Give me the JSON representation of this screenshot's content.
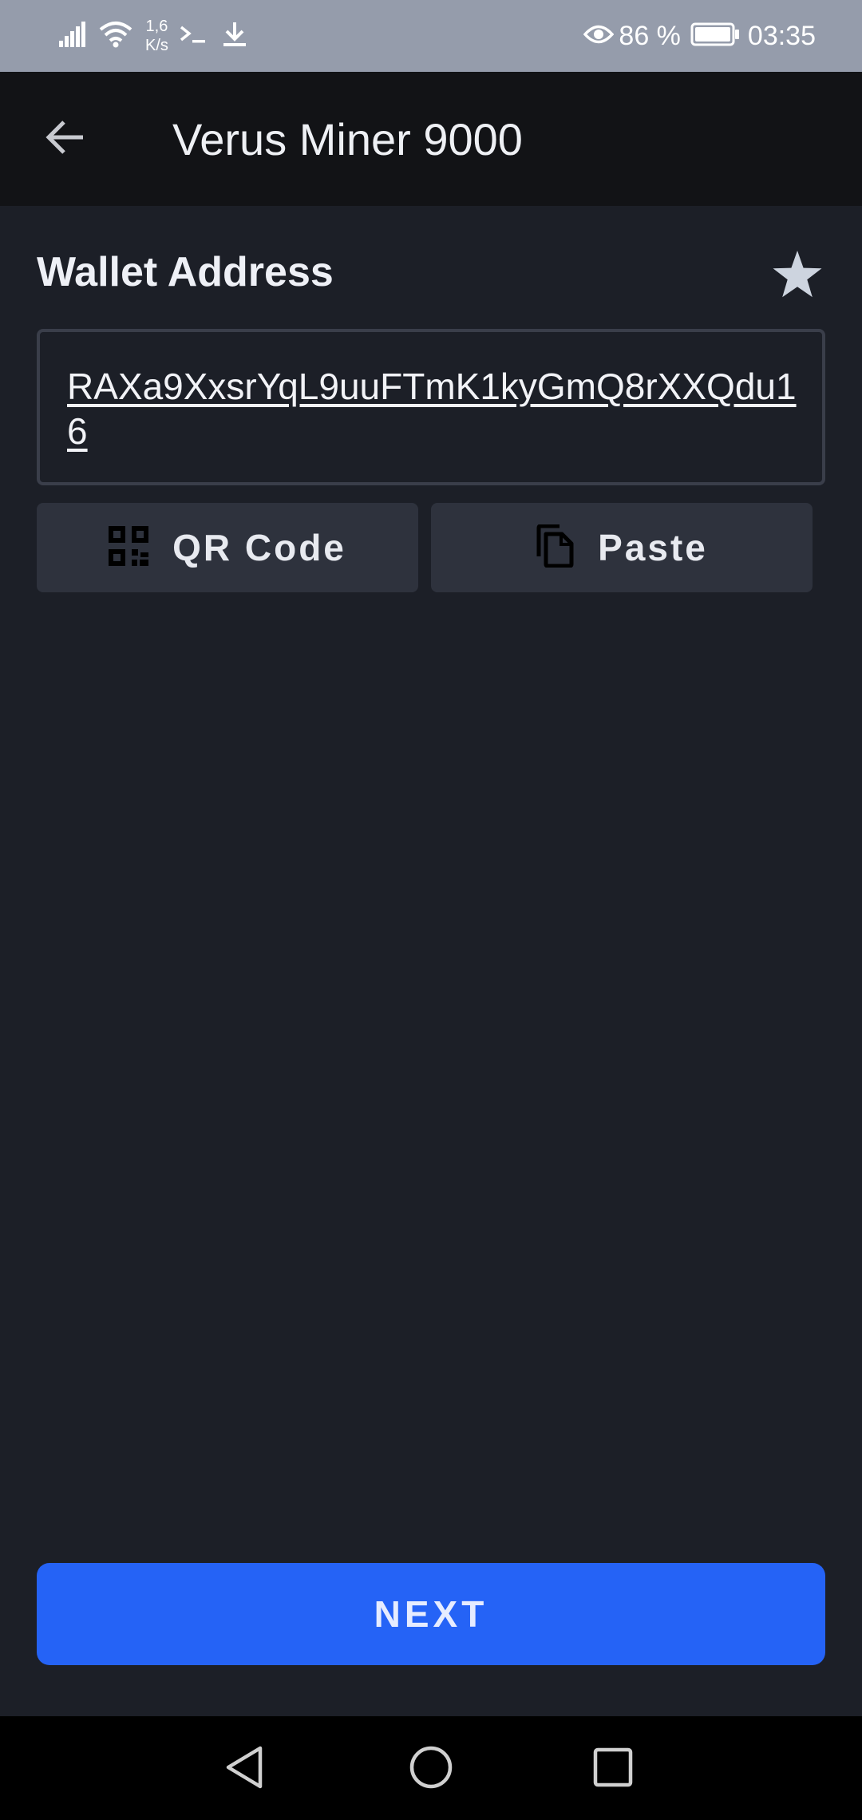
{
  "status_bar": {
    "net_speed_value": "1,6",
    "net_speed_unit": "K/s",
    "battery_percent": "86 %",
    "time": "03:35"
  },
  "app_bar": {
    "title": "Verus Miner 9000"
  },
  "wallet": {
    "section_title": "Wallet Address",
    "address_value": "RAXa9XxsrYqL9uuFTmK1kyGmQ8rXXQdu16"
  },
  "actions": {
    "qr_label": "QR Code",
    "paste_label": "Paste"
  },
  "footer": {
    "next_label": "NEXT"
  },
  "icons": [
    "signal-icon",
    "wifi-icon",
    "terminal-icon",
    "download-icon",
    "eye-icon",
    "battery-icon",
    "back-arrow-icon",
    "star-icon",
    "qr-code-icon",
    "paste-icon",
    "nav-back-icon",
    "nav-home-icon",
    "nav-recents-icon"
  ],
  "colors": {
    "background": "#1c1f27",
    "app_bar": "#121316",
    "status_bar": "#959cab",
    "button": "#2e323d",
    "accent": "#2563f6"
  }
}
